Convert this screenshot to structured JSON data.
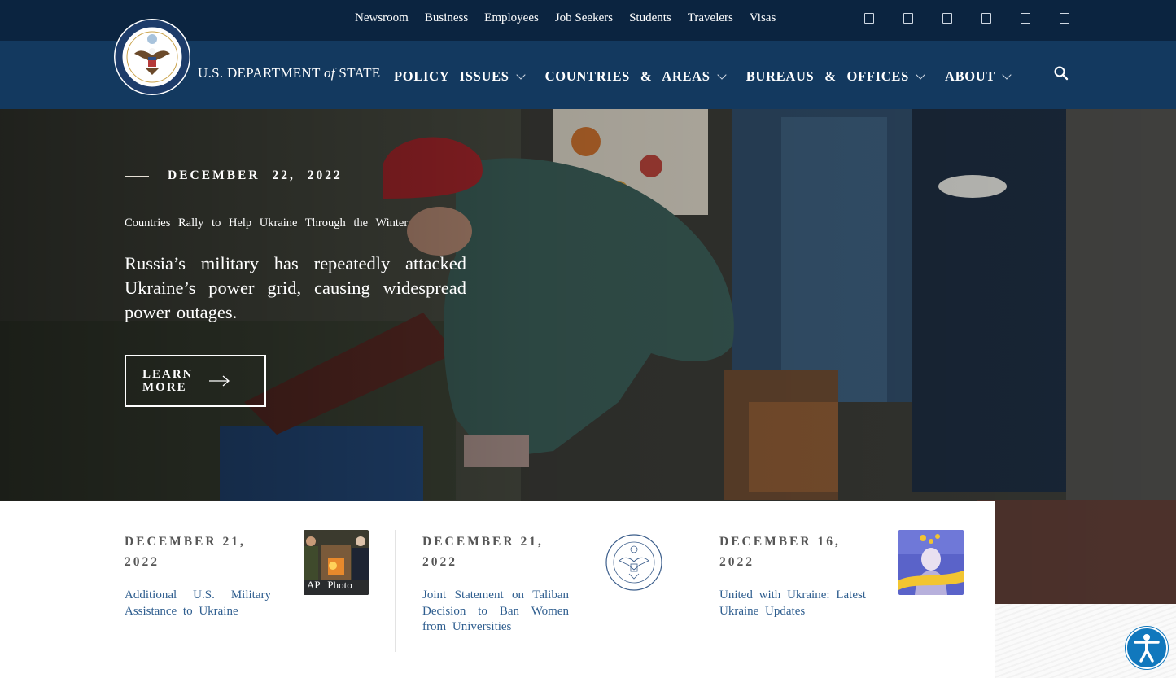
{
  "site": {
    "brand_prefix": "U.S. DEPARTMENT",
    "brand_of": "of",
    "brand_suffix": "STATE"
  },
  "topbar": {
    "links": [
      "Newsroom",
      "Business",
      "Employees",
      "Job Seekers",
      "Students",
      "Travelers",
      "Visas"
    ],
    "social_icons": [
      "facebook-icon",
      "twitter-icon",
      "youtube-icon",
      "flickr-icon",
      "instagram-icon",
      "rss-icon"
    ]
  },
  "nav": {
    "items": [
      "POLICY ISSUES",
      "COUNTRIES & AREAS",
      "BUREAUS & OFFICES",
      "ABOUT"
    ]
  },
  "hero": {
    "date": "DECEMBER 22, 2022",
    "kicker": "Countries Rally to Help Ukraine Through the Winter",
    "headline": "Russia’s military has repeatedly attacked Ukraine’s power grid, causing widespread power outages.",
    "button_label": "LEARN MORE"
  },
  "cards": [
    {
      "date": "DECEMBER 21, 2022",
      "title": "Additional U.S. Military Assistance to Ukraine",
      "thumb_caption": "AP Photo"
    },
    {
      "date": "DECEMBER 21, 2022",
      "title": "Joint Statement on Taliban Decision to Ban Women from Universities"
    },
    {
      "date": "DECEMBER 16, 2022",
      "title": "United with Ukraine: Latest Ukraine Updates"
    }
  ],
  "colors": {
    "topbar_bg": "#0b2440",
    "nav_bg": "#13395f",
    "link_blue": "#2f5e8f",
    "a11y_blue": "#1178bd"
  }
}
